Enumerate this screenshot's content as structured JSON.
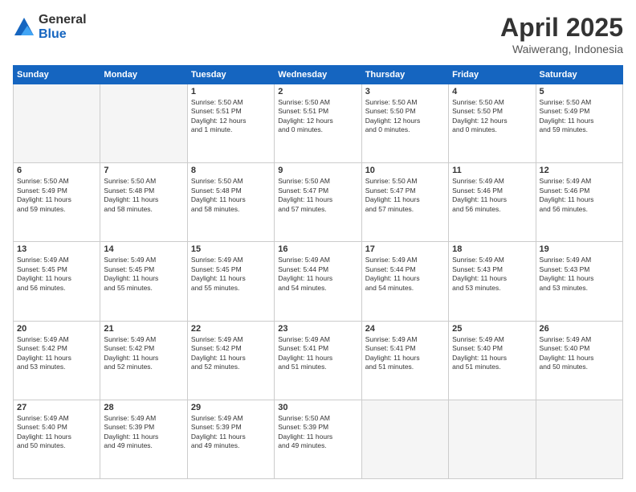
{
  "logo": {
    "general": "General",
    "blue": "Blue"
  },
  "title": "April 2025",
  "subtitle": "Waiwerang, Indonesia",
  "days_of_week": [
    "Sunday",
    "Monday",
    "Tuesday",
    "Wednesday",
    "Thursday",
    "Friday",
    "Saturday"
  ],
  "weeks": [
    [
      {
        "day": "",
        "info": ""
      },
      {
        "day": "",
        "info": ""
      },
      {
        "day": "1",
        "info": "Sunrise: 5:50 AM\nSunset: 5:51 PM\nDaylight: 12 hours\nand 1 minute."
      },
      {
        "day": "2",
        "info": "Sunrise: 5:50 AM\nSunset: 5:51 PM\nDaylight: 12 hours\nand 0 minutes."
      },
      {
        "day": "3",
        "info": "Sunrise: 5:50 AM\nSunset: 5:50 PM\nDaylight: 12 hours\nand 0 minutes."
      },
      {
        "day": "4",
        "info": "Sunrise: 5:50 AM\nSunset: 5:50 PM\nDaylight: 12 hours\nand 0 minutes."
      },
      {
        "day": "5",
        "info": "Sunrise: 5:50 AM\nSunset: 5:49 PM\nDaylight: 11 hours\nand 59 minutes."
      }
    ],
    [
      {
        "day": "6",
        "info": "Sunrise: 5:50 AM\nSunset: 5:49 PM\nDaylight: 11 hours\nand 59 minutes."
      },
      {
        "day": "7",
        "info": "Sunrise: 5:50 AM\nSunset: 5:48 PM\nDaylight: 11 hours\nand 58 minutes."
      },
      {
        "day": "8",
        "info": "Sunrise: 5:50 AM\nSunset: 5:48 PM\nDaylight: 11 hours\nand 58 minutes."
      },
      {
        "day": "9",
        "info": "Sunrise: 5:50 AM\nSunset: 5:47 PM\nDaylight: 11 hours\nand 57 minutes."
      },
      {
        "day": "10",
        "info": "Sunrise: 5:50 AM\nSunset: 5:47 PM\nDaylight: 11 hours\nand 57 minutes."
      },
      {
        "day": "11",
        "info": "Sunrise: 5:49 AM\nSunset: 5:46 PM\nDaylight: 11 hours\nand 56 minutes."
      },
      {
        "day": "12",
        "info": "Sunrise: 5:49 AM\nSunset: 5:46 PM\nDaylight: 11 hours\nand 56 minutes."
      }
    ],
    [
      {
        "day": "13",
        "info": "Sunrise: 5:49 AM\nSunset: 5:45 PM\nDaylight: 11 hours\nand 56 minutes."
      },
      {
        "day": "14",
        "info": "Sunrise: 5:49 AM\nSunset: 5:45 PM\nDaylight: 11 hours\nand 55 minutes."
      },
      {
        "day": "15",
        "info": "Sunrise: 5:49 AM\nSunset: 5:45 PM\nDaylight: 11 hours\nand 55 minutes."
      },
      {
        "day": "16",
        "info": "Sunrise: 5:49 AM\nSunset: 5:44 PM\nDaylight: 11 hours\nand 54 minutes."
      },
      {
        "day": "17",
        "info": "Sunrise: 5:49 AM\nSunset: 5:44 PM\nDaylight: 11 hours\nand 54 minutes."
      },
      {
        "day": "18",
        "info": "Sunrise: 5:49 AM\nSunset: 5:43 PM\nDaylight: 11 hours\nand 53 minutes."
      },
      {
        "day": "19",
        "info": "Sunrise: 5:49 AM\nSunset: 5:43 PM\nDaylight: 11 hours\nand 53 minutes."
      }
    ],
    [
      {
        "day": "20",
        "info": "Sunrise: 5:49 AM\nSunset: 5:42 PM\nDaylight: 11 hours\nand 53 minutes."
      },
      {
        "day": "21",
        "info": "Sunrise: 5:49 AM\nSunset: 5:42 PM\nDaylight: 11 hours\nand 52 minutes."
      },
      {
        "day": "22",
        "info": "Sunrise: 5:49 AM\nSunset: 5:42 PM\nDaylight: 11 hours\nand 52 minutes."
      },
      {
        "day": "23",
        "info": "Sunrise: 5:49 AM\nSunset: 5:41 PM\nDaylight: 11 hours\nand 51 minutes."
      },
      {
        "day": "24",
        "info": "Sunrise: 5:49 AM\nSunset: 5:41 PM\nDaylight: 11 hours\nand 51 minutes."
      },
      {
        "day": "25",
        "info": "Sunrise: 5:49 AM\nSunset: 5:40 PM\nDaylight: 11 hours\nand 51 minutes."
      },
      {
        "day": "26",
        "info": "Sunrise: 5:49 AM\nSunset: 5:40 PM\nDaylight: 11 hours\nand 50 minutes."
      }
    ],
    [
      {
        "day": "27",
        "info": "Sunrise: 5:49 AM\nSunset: 5:40 PM\nDaylight: 11 hours\nand 50 minutes."
      },
      {
        "day": "28",
        "info": "Sunrise: 5:49 AM\nSunset: 5:39 PM\nDaylight: 11 hours\nand 49 minutes."
      },
      {
        "day": "29",
        "info": "Sunrise: 5:49 AM\nSunset: 5:39 PM\nDaylight: 11 hours\nand 49 minutes."
      },
      {
        "day": "30",
        "info": "Sunrise: 5:50 AM\nSunset: 5:39 PM\nDaylight: 11 hours\nand 49 minutes."
      },
      {
        "day": "",
        "info": ""
      },
      {
        "day": "",
        "info": ""
      },
      {
        "day": "",
        "info": ""
      }
    ]
  ]
}
